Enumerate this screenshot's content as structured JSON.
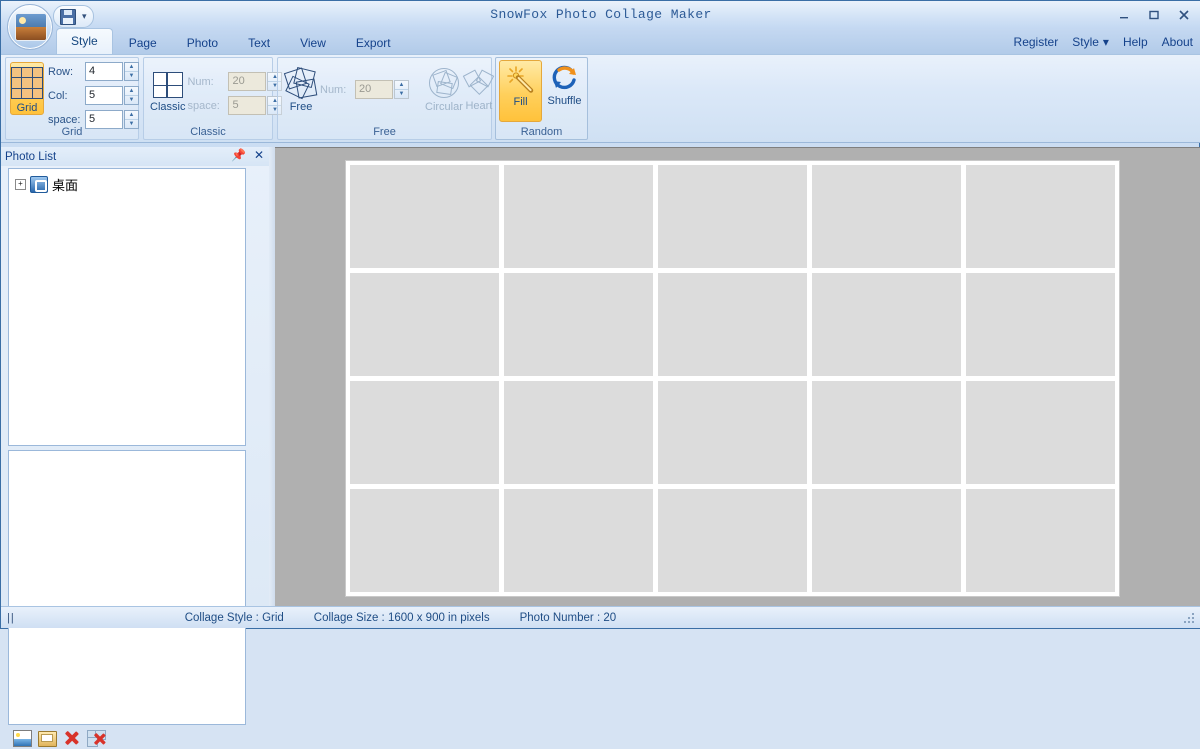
{
  "window": {
    "title": "SnowFox Photo Collage Maker",
    "minimize_label": "Minimize",
    "maximize_label": "Maximize",
    "close_label": "Close"
  },
  "quick_access": {
    "save_label": "Save",
    "dropdown_label": "Customize Quick Access Toolbar"
  },
  "tabs": [
    {
      "label": "Style",
      "active": true
    },
    {
      "label": "Page",
      "active": false
    },
    {
      "label": "Photo",
      "active": false
    },
    {
      "label": "Text",
      "active": false
    },
    {
      "label": "View",
      "active": false
    },
    {
      "label": "Export",
      "active": false
    }
  ],
  "menu_right": [
    {
      "label": "Register"
    },
    {
      "label": "Style"
    },
    {
      "label": "Help"
    },
    {
      "label": "About"
    }
  ],
  "ribbon": {
    "groups": [
      {
        "name": "Grid",
        "title": "Grid",
        "button_label": "Grid",
        "selected": true,
        "fields": [
          {
            "label": "Row:",
            "value": "4",
            "disabled": false
          },
          {
            "label": "Col:",
            "value": "5",
            "disabled": false
          },
          {
            "label": "space:",
            "value": "5",
            "disabled": false
          }
        ]
      },
      {
        "name": "Classic",
        "title": "Classic",
        "button_label": "Classic",
        "selected": false,
        "fields": [
          {
            "label": "Num:",
            "value": "20",
            "disabled": true
          },
          {
            "label": "space:",
            "value": "5",
            "disabled": true
          }
        ]
      },
      {
        "name": "Free",
        "title": "Free",
        "button_label": "Free",
        "selected": false,
        "fields": [
          {
            "label": "Num:",
            "value": "20",
            "disabled": true
          }
        ],
        "extra_buttons": [
          {
            "label": "Circular",
            "disabled": true
          },
          {
            "label": "Heart",
            "disabled": true
          }
        ]
      },
      {
        "name": "Random",
        "title": "Random",
        "buttons": [
          {
            "label": "Fill",
            "selected": true
          },
          {
            "label": "Shuffle",
            "selected": false
          }
        ]
      }
    ]
  },
  "photo_list": {
    "title": "Photo List",
    "pin_label": "Pin",
    "close_label": "Close",
    "tree": [
      {
        "label": "桌面",
        "expander": "+"
      }
    ],
    "toolbar": [
      {
        "name": "add-photo",
        "label": "Add Photo"
      },
      {
        "name": "add-folder",
        "label": "Add Folder"
      },
      {
        "name": "remove-photo",
        "label": "Remove Photo"
      },
      {
        "name": "remove-all-photos",
        "label": "Remove All Photos"
      }
    ]
  },
  "canvas": {
    "rows": 4,
    "cols": 5,
    "cell_count": 20,
    "paper_color": "#ffffff",
    "cell_color": "#dcdcdc",
    "background_color": "#b0b0b0"
  },
  "status_bar": {
    "collage_style": "Collage Style : Grid",
    "collage_size": "Collage Size : 1600 x 900  in pixels",
    "photo_number": "Photo Number : 20"
  },
  "colors": {
    "accent_blue": "#15428b",
    "highlight_orange": "#ffc23b",
    "title_text": "#2c5a96"
  }
}
